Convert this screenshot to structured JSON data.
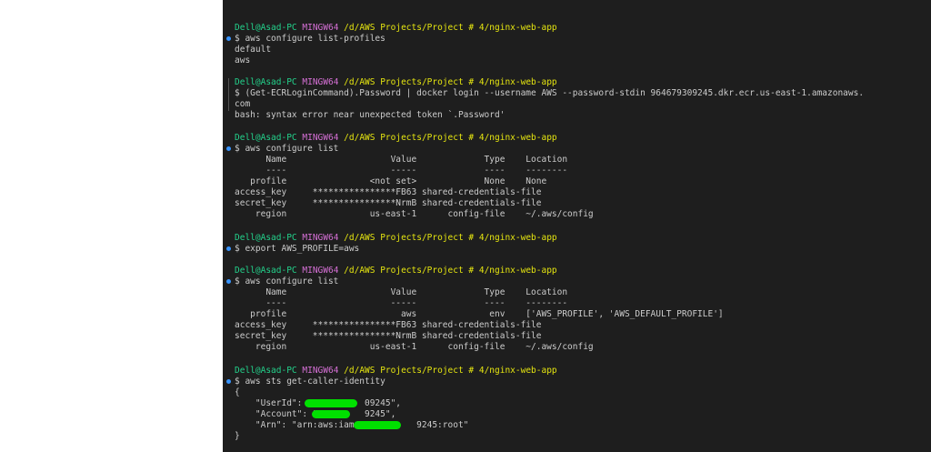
{
  "user_host": "Dell@Asad-PC",
  "shell": "MINGW64",
  "cwd": "/d/AWS Projects/Project # 4/nginx-web-app",
  "blocks": [
    {
      "command": "$ aws configure list-profiles",
      "output": [
        "default",
        "aws"
      ]
    },
    {
      "command": "$ (Get-ECRLoginCommand).Password | docker login --username AWS --password-stdin 964679309245.dkr.ecr.us-east-1.amazonaws.",
      "output": [
        "com",
        "bash: syntax error near unexpected token `.Password'"
      ]
    },
    {
      "command": "$ aws configure list",
      "output": [
        "      Name                    Value             Type    Location",
        "      ----                    -----             ----    --------",
        "   profile                <not set>             None    None",
        "access_key     ****************FB63 shared-credentials-file",
        "secret_key     ****************NrmB shared-credentials-file",
        "    region                us-east-1      config-file    ~/.aws/config"
      ]
    },
    {
      "command": "$ export AWS_PROFILE=aws",
      "output": []
    },
    {
      "command": "$ aws configure list",
      "output": [
        "      Name                    Value             Type    Location",
        "      ----                    -----             ----    --------",
        "   profile                      aws              env    ['AWS_PROFILE', 'AWS_DEFAULT_PROFILE']",
        "access_key     ****************FB63 shared-credentials-file",
        "secret_key     ****************NrmB shared-credentials-file",
        "    region                us-east-1      config-file    ~/.aws/config"
      ]
    },
    {
      "command": "$ aws sts get-caller-identity",
      "output": [
        "{",
        "    \"UserId\": \"          09245\",",
        "    \"Account\": \"         9245\",",
        "    \"Arn\": \"arn:aws:iam::          9245:root\"",
        "}"
      ]
    }
  ]
}
